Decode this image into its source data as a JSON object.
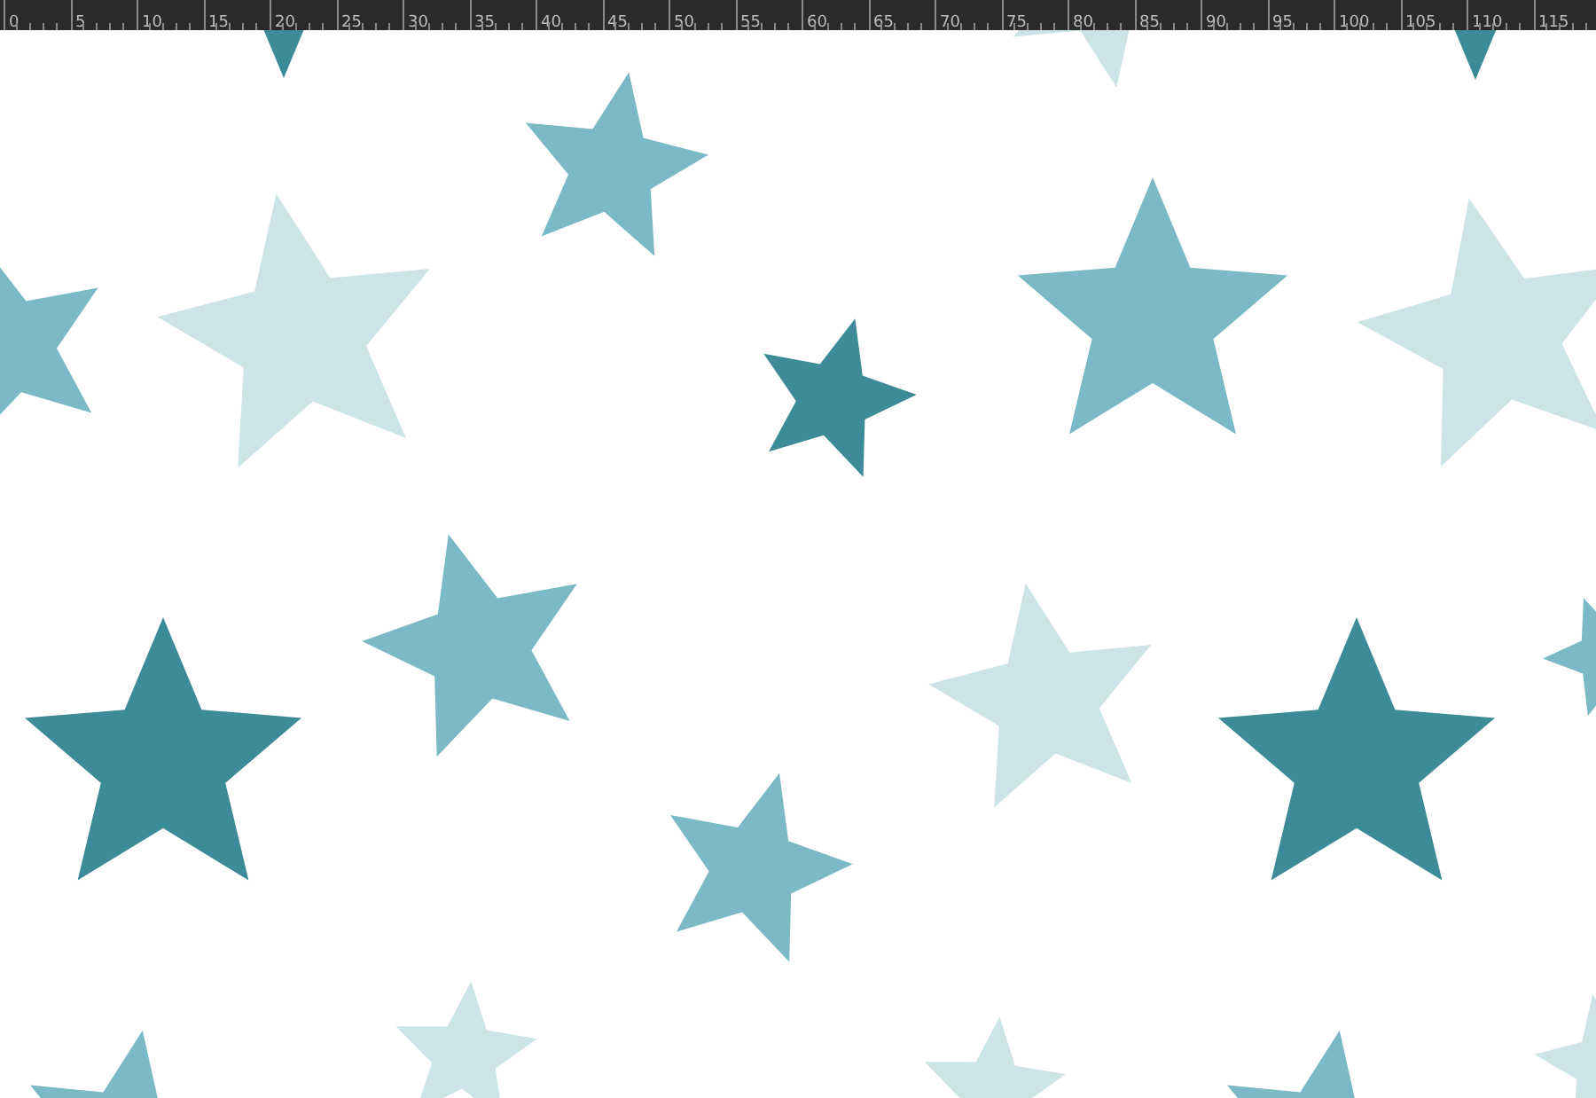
{
  "ruler": {
    "labels": [
      "0",
      "5",
      "10",
      "15",
      "20",
      "25",
      "30",
      "35",
      "40",
      "45",
      "50",
      "55",
      "60",
      "65",
      "70",
      "75",
      "80",
      "85",
      "90",
      "95",
      "100",
      "105",
      "110",
      "115"
    ]
  }
}
